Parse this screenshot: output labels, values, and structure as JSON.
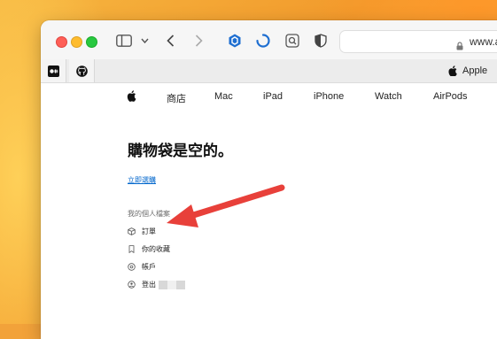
{
  "browser": {
    "address_url": "www.a",
    "active_tab_label": "Apple"
  },
  "apple_nav": {
    "items": [
      "商店",
      "Mac",
      "iPad",
      "iPhone",
      "Watch",
      "AirPods"
    ]
  },
  "bag": {
    "title": "購物袋是空的。",
    "shop_link": "立即選購",
    "section_label": "我的個人檔案",
    "menu": [
      {
        "label": "訂單",
        "icon": "box-icon"
      },
      {
        "label": "你的收藏",
        "icon": "bookmark-icon"
      },
      {
        "label": "帳戶",
        "icon": "gear-icon"
      },
      {
        "label": "登出",
        "icon": "person-icon"
      }
    ]
  },
  "colors": {
    "arrow": "#e8403a",
    "link": "#0066cc"
  }
}
